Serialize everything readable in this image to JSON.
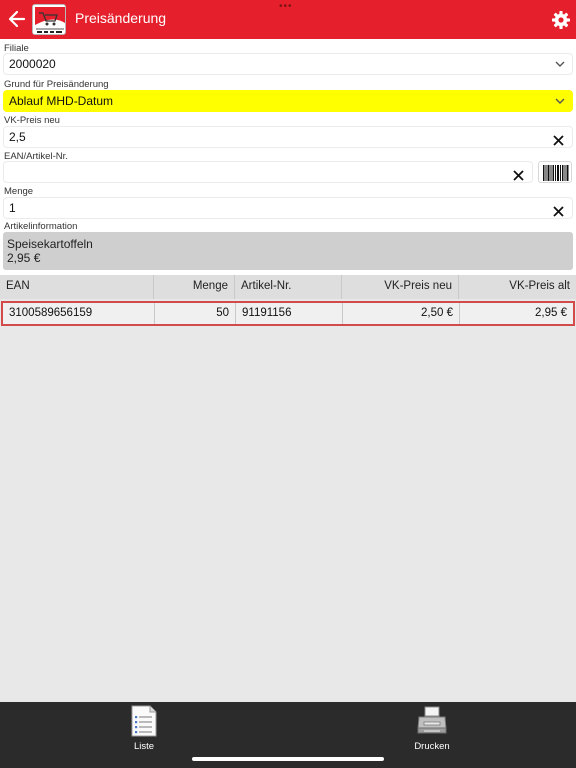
{
  "header": {
    "title": "Preisänderung",
    "dots": "•••"
  },
  "form": {
    "filiale": {
      "label": "Filiale",
      "value": "2000020"
    },
    "grund": {
      "label": "Grund für Preisänderung",
      "value": "Ablauf MHD-Datum",
      "highlight_color": "#ffff00"
    },
    "vkpreis": {
      "label": "VK-Preis neu",
      "value": "2,5"
    },
    "ean": {
      "label": "EAN/Artikel-Nr.",
      "value": ""
    },
    "menge": {
      "label": "Menge",
      "value": "1"
    },
    "artikelinfo": {
      "label": "Artikelinformation",
      "name": "Speisekartoffeln",
      "price": "2,95 €"
    }
  },
  "table": {
    "columns": [
      "EAN",
      "Menge",
      "Artikel-Nr.",
      "VK-Preis neu",
      "VK-Preis alt"
    ],
    "rows": [
      {
        "ean": "3100589656159",
        "menge": "50",
        "artikel": "91191156",
        "vk_neu": "2,50 €",
        "vk_alt": "2,95 €"
      }
    ]
  },
  "bottom_tabs": [
    {
      "label": "Liste",
      "icon": "list-icon"
    },
    {
      "label": "Drucken",
      "icon": "printer-icon"
    }
  ],
  "colors": {
    "accent": "#e5202c",
    "row_highlight_border": "#d24b4b",
    "bottom_bar": "#2b2b2b"
  }
}
